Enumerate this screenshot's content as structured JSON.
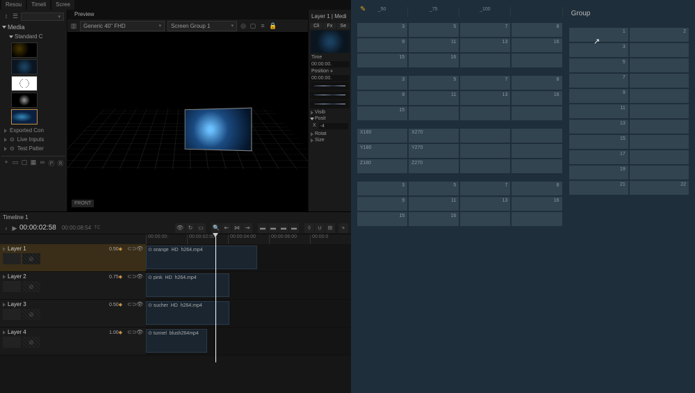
{
  "tabs": [
    "Resou",
    "Timeli",
    "Scree"
  ],
  "media": {
    "header": "Media",
    "group": "Standard C",
    "folders": [
      "Exported Con",
      "Live Inputs",
      "Test Patter"
    ]
  },
  "preview": {
    "tab": "Preview",
    "dd1": "Generic 40\" FHD",
    "dd2": "Screen Group 1",
    "front": "FRONT"
  },
  "inspector": {
    "title": "Layer 1 | Medi",
    "tabs": [
      "Cli",
      "Fx",
      "Se"
    ],
    "time_lbl": "Time",
    "time_val": "00:00:00.",
    "pos_lbl": "Position",
    "pos_val": "00:00:00.",
    "sections": [
      "Visib",
      "Posit",
      "Rotat",
      "Size"
    ],
    "x_lbl": "X",
    "x_val": "-4"
  },
  "timeline": {
    "name": "Timeline 1",
    "tc": "00:00:02:58",
    "tc2": "00:00:08:54",
    "ruler": [
      "00:00:00:",
      "00:00:02:00",
      "00:00:04:00",
      "00:00:06:00",
      "00:00:0"
    ],
    "layers": [
      {
        "name": "Layer 1",
        "op": "0.50",
        "clip": "orange_HD_h264.mp4",
        "sel": true,
        "th": "t2"
      },
      {
        "name": "Layer 2",
        "op": "0.75",
        "clip": "pink_HD_h264.mp4",
        "th": "t3"
      },
      {
        "name": "Layer 3",
        "op": "0.50",
        "clip": "sucher_HD_h264.mp4",
        "th": "t4"
      },
      {
        "name": "Layer 4",
        "op": "1.00",
        "clip": "tunnel_blush264mp4",
        "th": "t5"
      }
    ]
  },
  "right": {
    "group_lbl": "Group",
    "ruler": [
      "_50",
      "_75",
      "_100",
      ""
    ],
    "blocks": [
      [
        [
          "3",
          "5",
          "7",
          "8"
        ],
        [
          "9",
          "11",
          "13",
          "16"
        ],
        [
          "15",
          "16",
          "",
          ""
        ]
      ],
      [
        [
          "3",
          "5",
          "7",
          "8"
        ],
        [
          "9",
          "11",
          "13",
          "16"
        ],
        [
          "15",
          "",
          "",
          ""
        ]
      ],
      [
        [
          "X180",
          "X270",
          "",
          ""
        ],
        [
          "Y180",
          "Y270",
          "",
          ""
        ],
        [
          "Z180",
          "Z270",
          "",
          ""
        ]
      ],
      [
        [
          "3",
          "5",
          "7",
          "8"
        ],
        [
          "9",
          "11",
          "13",
          "16"
        ],
        [
          "15",
          "16",
          "",
          ""
        ]
      ]
    ],
    "side": [
      [
        "1",
        "2"
      ],
      [
        "3",
        ""
      ],
      [
        "5",
        ""
      ],
      [
        "7",
        ""
      ],
      [
        "9",
        ""
      ],
      [
        "11",
        ""
      ],
      [
        "13",
        ""
      ],
      [
        "15",
        ""
      ],
      [
        "17",
        ""
      ],
      [
        "19",
        ""
      ],
      [
        "21",
        "22"
      ]
    ]
  }
}
